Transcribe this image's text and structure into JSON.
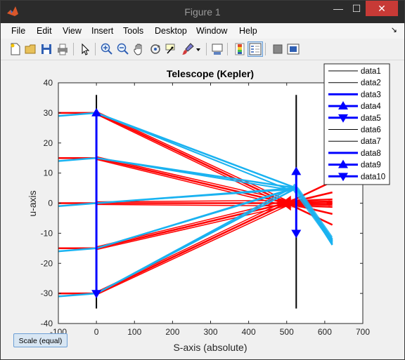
{
  "window": {
    "title": "Figure 1",
    "controls": {
      "minimize": "—",
      "maximize": "☐",
      "close": "✕"
    }
  },
  "menu": [
    "File",
    "Edit",
    "View",
    "Insert",
    "Tools",
    "Desktop",
    "Window",
    "Help"
  ],
  "toolbar": {
    "buttons": [
      "new-figure-icon",
      "open-file-icon",
      "save-icon",
      "print-icon",
      "edit-plot-arrow-icon",
      "zoom-in-icon",
      "zoom-out-icon",
      "pan-hand-icon",
      "rotate-3d-icon",
      "data-cursor-icon",
      "brush-icon",
      "brush-dropdown-icon",
      "link-plot-icon",
      "insert-colorbar-icon",
      "insert-legend-icon",
      "hide-plot-tools-icon",
      "show-plot-tools-icon"
    ]
  },
  "colors": {
    "red": "#ff0000",
    "cyan": "#1ab2f0",
    "blue": "#0000ff",
    "black": "#000000"
  },
  "scale_button": {
    "label": "Scale (equal)"
  },
  "chart_data": {
    "type": "line",
    "title": "Telescope (Kepler)",
    "xlabel": "S-axis (absolute)",
    "ylabel": "u-axis",
    "xlim": [
      -100,
      700
    ],
    "ylim": [
      -40,
      40
    ],
    "xticks": [
      "-100",
      "0",
      "100",
      "200",
      "300",
      "400",
      "500",
      "600",
      "700"
    ],
    "yticks": [
      "40",
      "30",
      "20",
      "10",
      "0",
      "-10",
      "-20",
      "-30",
      "-40"
    ],
    "legend": [
      "data1",
      "data2",
      "data3",
      "data4",
      "data5",
      "data6",
      "data7",
      "data8",
      "data9",
      "data10"
    ],
    "legend_placement": "top-right",
    "series": [
      {
        "name": "data1",
        "type": "line",
        "color": "#000000",
        "points": [
          [
            0,
            -35
          ],
          [
            0,
            36
          ]
        ]
      },
      {
        "name": "data2",
        "type": "line",
        "color": "#000000",
        "points": [
          [
            525,
            -35
          ],
          [
            525,
            36
          ]
        ]
      },
      {
        "name": "data3",
        "type": "line",
        "color": "#0000ff",
        "points": [
          [
            0,
            -30
          ],
          [
            0,
            30
          ]
        ]
      },
      {
        "name": "data4",
        "type": "marker",
        "color": "#0000ff",
        "marker": "up-triangle",
        "points": [
          [
            0,
            30
          ],
          [
            525,
            10.5
          ]
        ]
      },
      {
        "name": "data5",
        "type": "marker",
        "color": "#0000ff",
        "marker": "down-triangle",
        "points": [
          [
            0,
            -30
          ],
          [
            525,
            -10
          ]
        ]
      },
      {
        "name": "data8",
        "type": "line",
        "color": "#0000ff",
        "points": [
          [
            525,
            -10
          ],
          [
            525,
            10.5
          ]
        ]
      }
    ],
    "ray_heights": [
      30,
      15,
      0,
      -15,
      -30
    ],
    "red_rays": {
      "start_x": -100,
      "lens1_x": 0,
      "focus": [
        500,
        0
      ],
      "end_x": 620,
      "color": "#ff0000"
    },
    "cyan_rays": {
      "start_x": -100,
      "lens1_x": 0,
      "cross": [
        525,
        5
      ],
      "end_x": 620,
      "color": "#1ab2f0"
    }
  }
}
